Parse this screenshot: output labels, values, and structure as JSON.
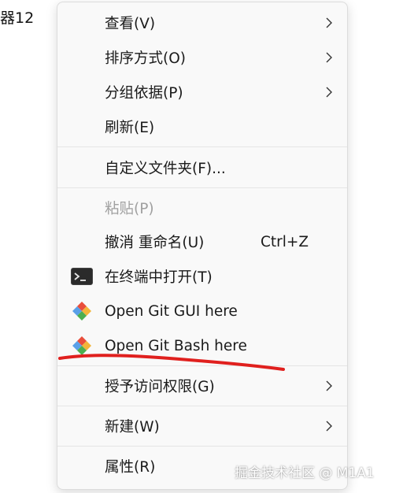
{
  "background": {
    "window_title_fragment": "器12"
  },
  "menu": {
    "items": [
      {
        "label": "查看(V)",
        "has_submenu": true
      },
      {
        "label": "排序方式(O)",
        "has_submenu": true
      },
      {
        "label": "分组依据(P)",
        "has_submenu": true
      },
      {
        "label": "刷新(E)"
      },
      {
        "label": "自定义文件夹(F)..."
      },
      {
        "label": "粘贴(P)",
        "disabled": true
      },
      {
        "label": "撤消 重命名(U)",
        "shortcut": "Ctrl+Z"
      },
      {
        "label": "在终端中打开(T)",
        "icon": "terminal-icon"
      },
      {
        "label": "Open Git GUI here",
        "icon": "git-gui-icon"
      },
      {
        "label": "Open Git Bash here",
        "icon": "git-bash-icon"
      },
      {
        "label": "授予访问权限(G)",
        "has_submenu": true
      },
      {
        "label": "新建(W)",
        "has_submenu": true
      },
      {
        "label": "属性(R)"
      }
    ]
  },
  "annotation": {
    "color": "#e0201e"
  },
  "watermark": "掘金技术社区 @ M1A1"
}
